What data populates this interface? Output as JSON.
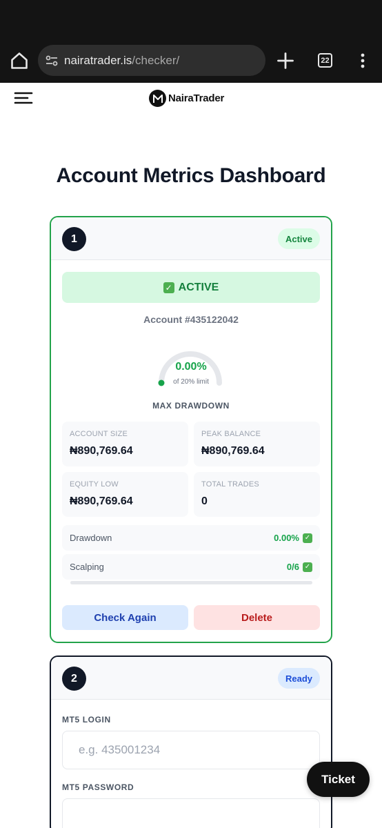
{
  "browser": {
    "url_domain": "nairatrader.is",
    "url_path": "/checker/",
    "tab_count": "22"
  },
  "site": {
    "logo_text": "NairaTrader",
    "page_title": "Account Metrics Dashboard"
  },
  "cards": [
    {
      "number": "1",
      "status_pill": "Active",
      "banner_text": "ACTIVE",
      "account_line": "Account #435122042",
      "gauge": {
        "value": "0.00%",
        "subtext": "of 20% limit",
        "fill_fraction": 0,
        "color": "#16a34a"
      },
      "gauge_caption": "MAX DRAWDOWN",
      "stats": [
        {
          "label": "ACCOUNT SIZE",
          "value": "₦890,769.64"
        },
        {
          "label": "PEAK BALANCE",
          "value": "₦890,769.64"
        },
        {
          "label": "EQUITY LOW",
          "value": "₦890,769.64"
        },
        {
          "label": "TOTAL TRADES",
          "value": "0"
        }
      ],
      "rules": [
        {
          "label": "Drawdown",
          "value": "0.00%"
        },
        {
          "label": "Scalping",
          "value": "0/6",
          "progress": 0
        }
      ],
      "buttons": {
        "check_again": "Check Again",
        "delete": "Delete"
      }
    },
    {
      "number": "2",
      "status_pill": "Ready",
      "login_label": "MT5 LOGIN",
      "login_placeholder": "e.g. 435001234",
      "password_label": "MT5 PASSWORD"
    }
  ],
  "ticket_button": "Ticket",
  "colors": {
    "active_green": "#16a34a",
    "card1_border": "#22a34a",
    "dark": "#111827"
  },
  "icons": [
    "home-icon",
    "site-info-icon",
    "new-tab-icon",
    "tab-switcher-icon",
    "more-menu-icon",
    "hamburger-icon",
    "check-mark-icon"
  ]
}
